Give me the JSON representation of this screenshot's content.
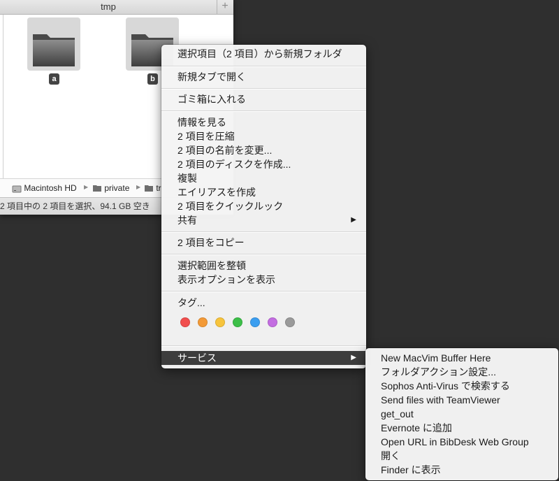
{
  "finder": {
    "title": "tmp",
    "add_tab": "+",
    "items": [
      {
        "name": "a"
      },
      {
        "name": "b"
      }
    ],
    "path": [
      "Macintosh HD",
      "private",
      "tr"
    ],
    "status": "2 項目中の 2 項目を選択、94.1 GB 空き"
  },
  "menu": {
    "items": [
      "選択項目（2 項目）から新規フォルダ",
      "新規タブで開く",
      "ゴミ箱に入れる",
      "情報を見る",
      "2 項目を圧縮",
      "2 項目の名前を変更...",
      "2 項目のディスクを作成...",
      "複製",
      "エイリアスを作成",
      "2 項目をクイックルック",
      "共有",
      "2 項目をコピー",
      "選択範囲を整頓",
      "表示オプションを表示",
      "タグ...",
      "サービス"
    ],
    "submenu_arrow": "▶",
    "tag_colors": [
      "#f14e4d",
      "#f39a37",
      "#f7c43c",
      "#3cbf48",
      "#3b9ef0",
      "#c36de1",
      "#9a9a9a"
    ]
  },
  "services": {
    "items": [
      "New MacVim Buffer Here",
      "フォルダアクション設定...",
      "Sophos Anti-Virus で検索する",
      "Send files with TeamViewer",
      "get_out",
      "Evernote に追加",
      "Open URL in BibDesk Web Group",
      "開く",
      "Finder に表示"
    ]
  }
}
